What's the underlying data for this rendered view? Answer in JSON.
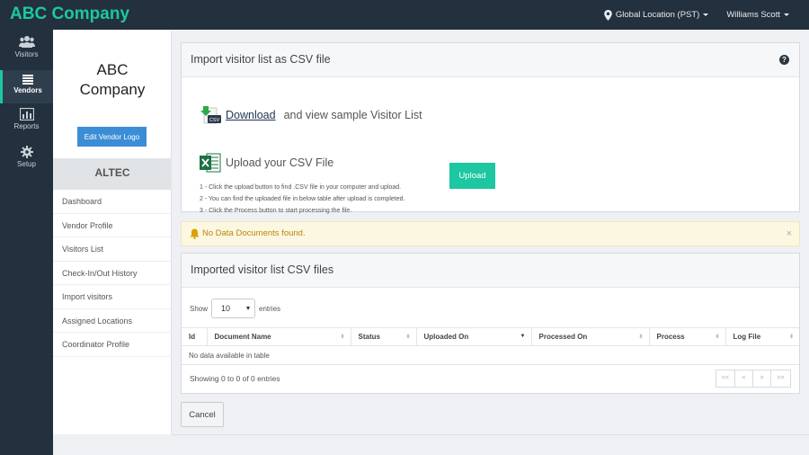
{
  "app": {
    "brand": "ABC Company"
  },
  "topbar": {
    "location": "Global Location (PST)",
    "user": "Williams Scott"
  },
  "leftnav": [
    {
      "label": "Visitors",
      "icon": "users-icon"
    },
    {
      "label": "Vendors",
      "icon": "list-icon",
      "active": true
    },
    {
      "label": "Reports",
      "icon": "bar-chart-icon"
    },
    {
      "label": "Setup",
      "icon": "gear-icon"
    }
  ],
  "sidebar": {
    "company_line1": "ABC",
    "company_line2": "Company",
    "logo_button": "Edit Vendor Logo",
    "vendor": "ALTEC",
    "menu": [
      "Dashboard",
      "Vendor Profile",
      "Visitors List",
      "Check-In/Out History",
      "Import visitors",
      "Assigned Locations",
      "Coordinator Profile"
    ]
  },
  "import_panel": {
    "title": "Import visitor list as CSV file",
    "help": "?",
    "download_link": "Download",
    "download_text": "and view sample Visitor List",
    "csv_badge": "CSV",
    "upload_title": "Upload your CSV File",
    "steps": [
      "1 - Click the upload button to find .CSV file in your computer and upload.",
      "2 - You can find the uploaded file in below table after upload is completed.",
      "3 - Click the Process button to start processing the file."
    ],
    "upload_button": "Upload"
  },
  "alert": {
    "text": "No Data Documents found.",
    "close": "×"
  },
  "files_panel": {
    "title": "Imported visitor list CSV files",
    "show_label": "Show",
    "entries_value": "10",
    "entries_label": "entries",
    "columns": [
      "Id",
      "Document Name",
      "Status",
      "Uploaded On",
      "Processed On",
      "Process",
      "Log File"
    ],
    "empty_text": "No data available in table",
    "info": "Showing 0 to 0 of 0 entries",
    "pager": [
      "<<",
      "<",
      ">",
      ">>"
    ]
  },
  "cancel_button": "Cancel",
  "colors": {
    "accent": "#1cc7a1",
    "nav_bg": "#23303d",
    "primary": "#3b8ed6",
    "warning": "#b8860b"
  }
}
